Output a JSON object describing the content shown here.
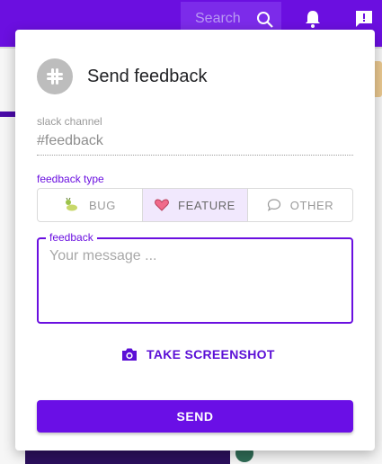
{
  "header": {
    "search_placeholder": "Search",
    "icons": [
      "search-icon",
      "bell-icon",
      "feedback-icon"
    ]
  },
  "dialog": {
    "title": "Send feedback",
    "logo_icon": "slack-logo-icon",
    "slack_channel": {
      "label": "slack channel",
      "value": "#feedback"
    },
    "feedback_type": {
      "label": "feedback type",
      "options": [
        {
          "label": "BUG",
          "icon": "bug-icon",
          "selected": false
        },
        {
          "label": "FEATURE",
          "icon": "heart-icon",
          "selected": true
        },
        {
          "label": "OTHER",
          "icon": "speech-bubble-icon",
          "selected": false
        }
      ]
    },
    "feedback": {
      "label": "feedback",
      "placeholder": "Your message ..."
    },
    "screenshot_button": {
      "label": "TAKE SCREENSHOT",
      "icon": "camera-icon"
    },
    "send_button": {
      "label": "SEND"
    }
  },
  "colors": {
    "accent": "#6a0fe6",
    "header": "#6b0fe0",
    "selected_bg": "#f1e8fd"
  }
}
